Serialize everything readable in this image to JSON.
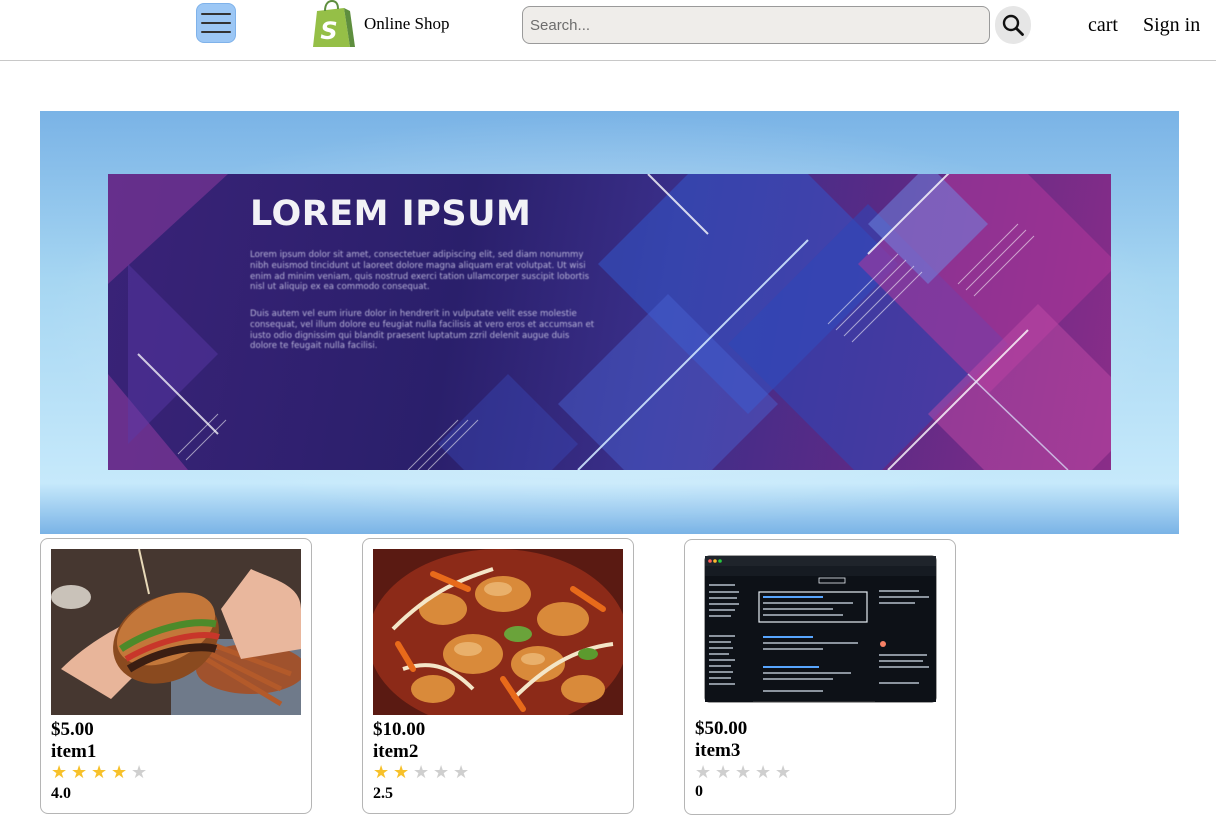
{
  "header": {
    "brand": "Online Shop",
    "search_placeholder": "Search...",
    "cart_label": "cart",
    "signin_label": "Sign in",
    "logo_color": "#5e8e3e",
    "menu_button_color": "#9cc7f5"
  },
  "banner": {
    "title": "LOREM IPSUM",
    "paragraph_1": "Lorem ipsum dolor sit amet, consectetuer adipiscing elit, sed diam nonummy nibh euismod tincidunt ut laoreet dolore magna aliquam erat volutpat. Ut wisi enim ad minim veniam, quis nostrud exerci tation ullamcorper suscipit lobortis nisl ut aliquip ex ea commodo consequat.",
    "paragraph_2": "Duis autem vel eum iriure dolor in hendrerit in vulputate velit esse molestie consequat, vel illum dolore eu feugiat nulla facilisis at vero eros et accumsan et iusto odio dignissim qui blandit praesent luptatum zzril delenit augue duis dolore te feugait nulla facilisi."
  },
  "products": [
    {
      "price": "$5.00",
      "name": "item1",
      "rating": "4.0",
      "rating_value": 4.0,
      "image": "burger-photo"
    },
    {
      "price": "$10.00",
      "name": "item2",
      "rating": "2.5",
      "rating_value": 2.5,
      "image": "stir-fry-photo"
    },
    {
      "price": "$50.00",
      "name": "item3",
      "rating": "0",
      "rating_value": 0,
      "image": "app-screenshot"
    }
  ],
  "star_colors": {
    "filled": "#f7c12a",
    "empty": "#cfcfcf"
  }
}
